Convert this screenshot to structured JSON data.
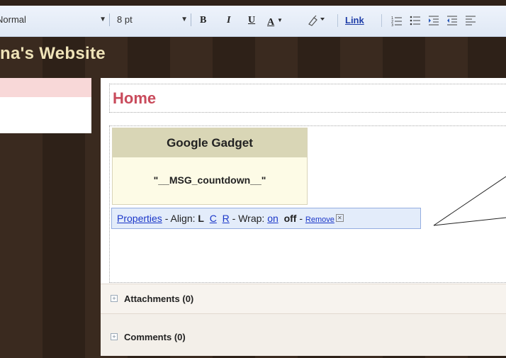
{
  "toolbar": {
    "style_select": "Normal",
    "size_select": "8 pt",
    "bold": "B",
    "italic": "I",
    "underline": "U",
    "text_color": "A",
    "link": "Link"
  },
  "site": {
    "title": "na's Website"
  },
  "page": {
    "title": "Home"
  },
  "gadget": {
    "header": "Google Gadget",
    "message": "\"__MSG_countdown__\""
  },
  "properties_bar": {
    "properties_link": "Properties",
    "align_label": " - Align: ",
    "align_left": "L",
    "align_center": "C",
    "align_right": "R",
    "wrap_label": " - Wrap: ",
    "wrap_on": "on",
    "wrap_off": "off",
    "dash": " - ",
    "remove_link": "Remove"
  },
  "sections": {
    "attachments_label": "Attachments",
    "attachments_count": "(0)",
    "comments_label": "Comments",
    "comments_count": "(0)"
  },
  "colors": {
    "page_title": "#c94b5c",
    "site_title": "#efe3b8",
    "link": "#1a36c8",
    "background": "#2f2118"
  }
}
